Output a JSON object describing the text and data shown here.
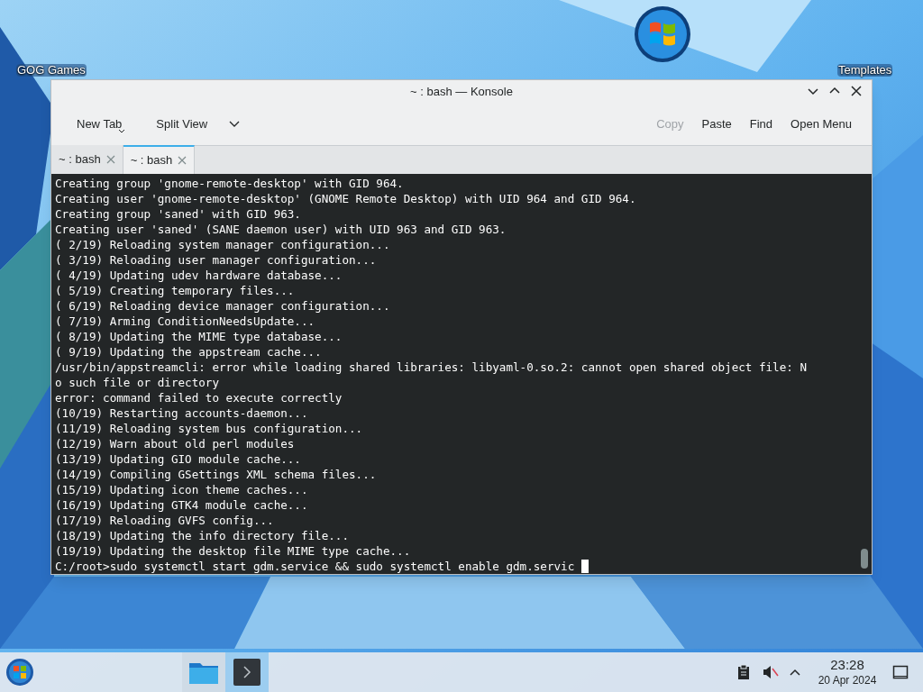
{
  "desktop": {
    "icons": [
      {
        "label": "GOG Games",
        "kind": "text"
      },
      {
        "kind": "windows-logo"
      },
      {
        "label": "Templates",
        "kind": "text"
      }
    ]
  },
  "window": {
    "title": "~ : bash — Konsole",
    "toolbar": {
      "left": [
        {
          "label": "New Tab",
          "kind": "dropdown-below"
        },
        {
          "label": "Split View",
          "kind": "dropdown-side"
        }
      ],
      "right": [
        {
          "label": "Copy",
          "disabled": true
        },
        {
          "label": "Paste",
          "disabled": false
        },
        {
          "label": "Find",
          "disabled": false
        },
        {
          "label": "Open Menu",
          "disabled": false
        }
      ]
    },
    "tabs": [
      {
        "label": "~ : bash",
        "selected": false
      },
      {
        "label": "~ : bash",
        "selected": true
      }
    ],
    "terminal": {
      "lines": [
        "Creating group 'gnome-remote-desktop' with GID 964.",
        "Creating user 'gnome-remote-desktop' (GNOME Remote Desktop) with UID 964 and GID 964.",
        "Creating group 'saned' with GID 963.",
        "Creating user 'saned' (SANE daemon user) with UID 963 and GID 963.",
        "( 2/19) Reloading system manager configuration...",
        "( 3/19) Reloading user manager configuration...",
        "( 4/19) Updating udev hardware database...",
        "( 5/19) Creating temporary files...",
        "( 6/19) Reloading device manager configuration...",
        "( 7/19) Arming ConditionNeedsUpdate...",
        "( 8/19) Updating the MIME type database...",
        "( 9/19) Updating the appstream cache...",
        "/usr/bin/appstreamcli: error while loading shared libraries: libyaml-0.so.2: cannot open shared object file: N",
        "o such file or directory",
        "error: command failed to execute correctly",
        "(10/19) Restarting accounts-daemon...",
        "(11/19) Reloading system bus configuration...",
        "(12/19) Warn about old perl modules",
        "(13/19) Updating GIO module cache...",
        "(14/19) Compiling GSettings XML schema files...",
        "(15/19) Updating icon theme caches...",
        "(16/19) Updating GTK4 module cache...",
        "(17/19) Reloading GVFS config...",
        "(18/19) Updating the info directory file...",
        "(19/19) Updating the desktop file MIME type cache..."
      ],
      "prompt": "C:/root>sudo systemctl start gdm.service && sudo systemctl enable gdm.servic"
    }
  },
  "taskbar": {
    "tasks": [
      {
        "kind": "folder",
        "selected": false
      },
      {
        "kind": "terminal",
        "selected": true
      }
    ],
    "clock": {
      "time": "23:28",
      "date": "20 Apr 2024"
    }
  }
}
